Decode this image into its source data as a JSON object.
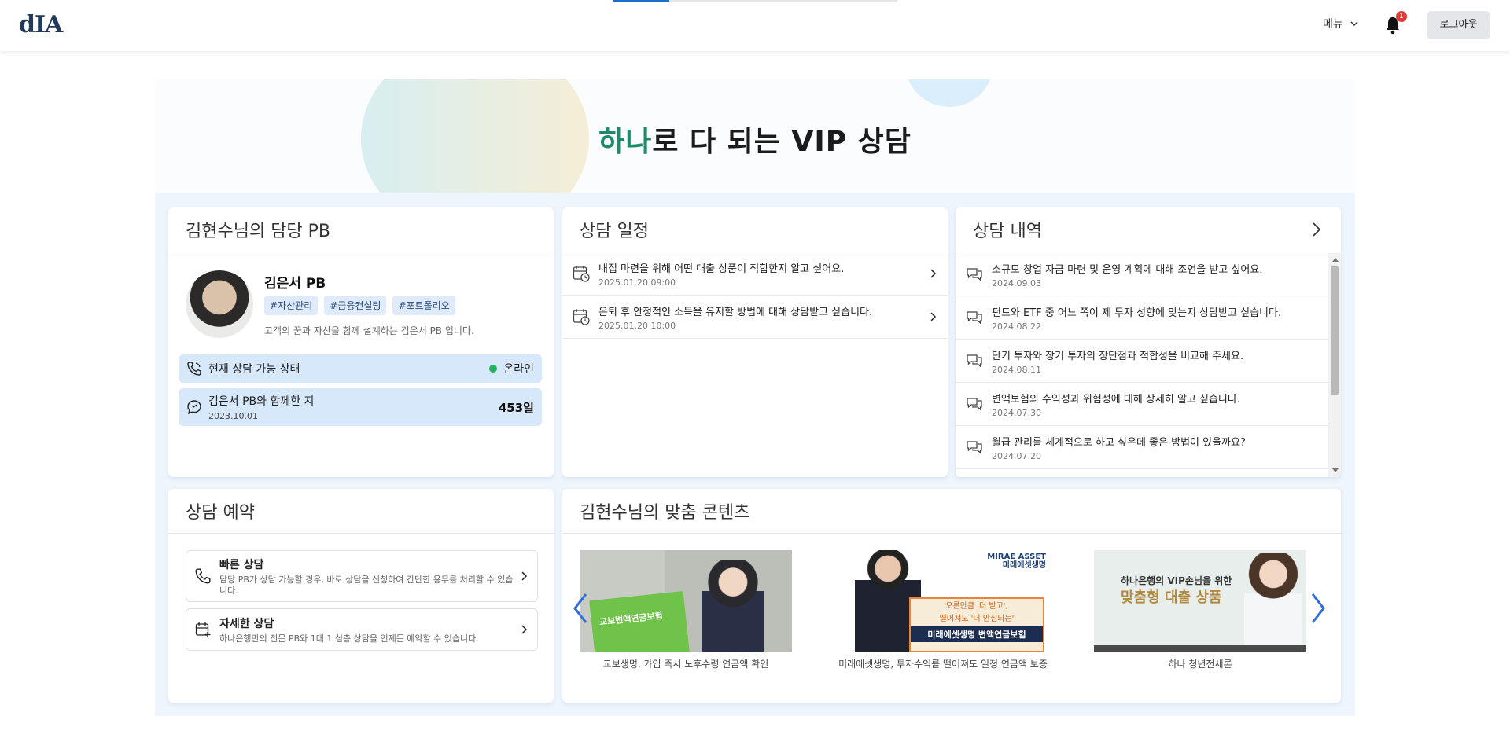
{
  "header": {
    "logo": "dIA",
    "menu_label": "메뉴",
    "notification_count": "1",
    "logout_label": "로그아웃"
  },
  "banner": {
    "title_accent": "하나",
    "title_rest": "로 다 되는 VIP 상담"
  },
  "pb_card": {
    "title": "김현수님의 담당 PB",
    "name": "김은서 PB",
    "tags": [
      "#자산관리",
      "#금융컨설팅",
      "#포트폴리오"
    ],
    "description": "고객의 꿈과 자산을 함께 설계하는 김은서 PB 입니다.",
    "status_label": "현재 상담 가능 상태",
    "status_value": "온라인",
    "status_color": "#22b35e",
    "together_label": "김은서 PB와 함께한 지",
    "together_date": "2023.10.01",
    "together_days": "453일"
  },
  "schedule_card": {
    "title": "상담 일정",
    "items": [
      {
        "title": "내집 마련을 위해 어떤 대출 상품이 적합한지 알고 싶어요.",
        "date": "2025.01.20 09:00"
      },
      {
        "title": "은퇴 후 안정적인 소득을 유지할 방법에 대해 상담받고 싶습니다.",
        "date": "2025.01.20 10:00"
      }
    ]
  },
  "history_card": {
    "title": "상담 내역",
    "items": [
      {
        "title": "소규모 창업 자금 마련 및 운영 계획에 대해 조언을 받고 싶어요.",
        "date": "2024.09.03"
      },
      {
        "title": "펀드와 ETF 중 어느 쪽이 제 투자 성향에 맞는지 상담받고 싶습니다.",
        "date": "2024.08.22"
      },
      {
        "title": "단기 투자와 장기 투자의 장단점과 적합성을 비교해 주세요.",
        "date": "2024.08.11"
      },
      {
        "title": "변액보험의 수익성과 위험성에 대해 상세히 알고 싶습니다.",
        "date": "2024.07.30"
      },
      {
        "title": "월급 관리를 체계적으로 하고 싶은데 좋은 방법이 있을까요?",
        "date": "2024.07.20"
      }
    ]
  },
  "reserve_card": {
    "title": "상담 예약",
    "quick": {
      "title": "빠른 상담",
      "desc": "담당 PB가 상담 가능할 경우, 바로 상담을 신청하여 간단한 용무를 처리할 수 있습니다."
    },
    "detail": {
      "title": "자세한 상담",
      "desc": "하나은행만의 전문 PB와 1대 1 심층 상담을 언제든 예약할 수 있습니다."
    }
  },
  "contents_card": {
    "title": "김현수님의 맞춤 콘텐츠",
    "items": [
      {
        "caption": "교보생명, 가입 즉시 노후수령 연금액 확인",
        "image_text": "교보변액연금보험"
      },
      {
        "caption": "미래에셋생명, 투자수익률 떨어져도 일정 연금액 보증",
        "brand": "MIRAE ASSET",
        "brand_sub": "미래에셋생명",
        "image_text_1": "오른만큼 '더 받고',",
        "image_text_2": "떨어져도 '더 안심되는'",
        "image_text_3": "미래에셋생명 변액연금보험"
      },
      {
        "caption": "하나 청년전세론",
        "image_text_1": "하나은행의 VIP손님을 위한",
        "image_text_2": "맞춤형 대출 상품"
      }
    ]
  },
  "colors": {
    "accent_green": "#1f8a6a",
    "primary_blue": "#1a6fc9",
    "light_blue": "#d8e8fb",
    "badge_red": "#e53935"
  }
}
